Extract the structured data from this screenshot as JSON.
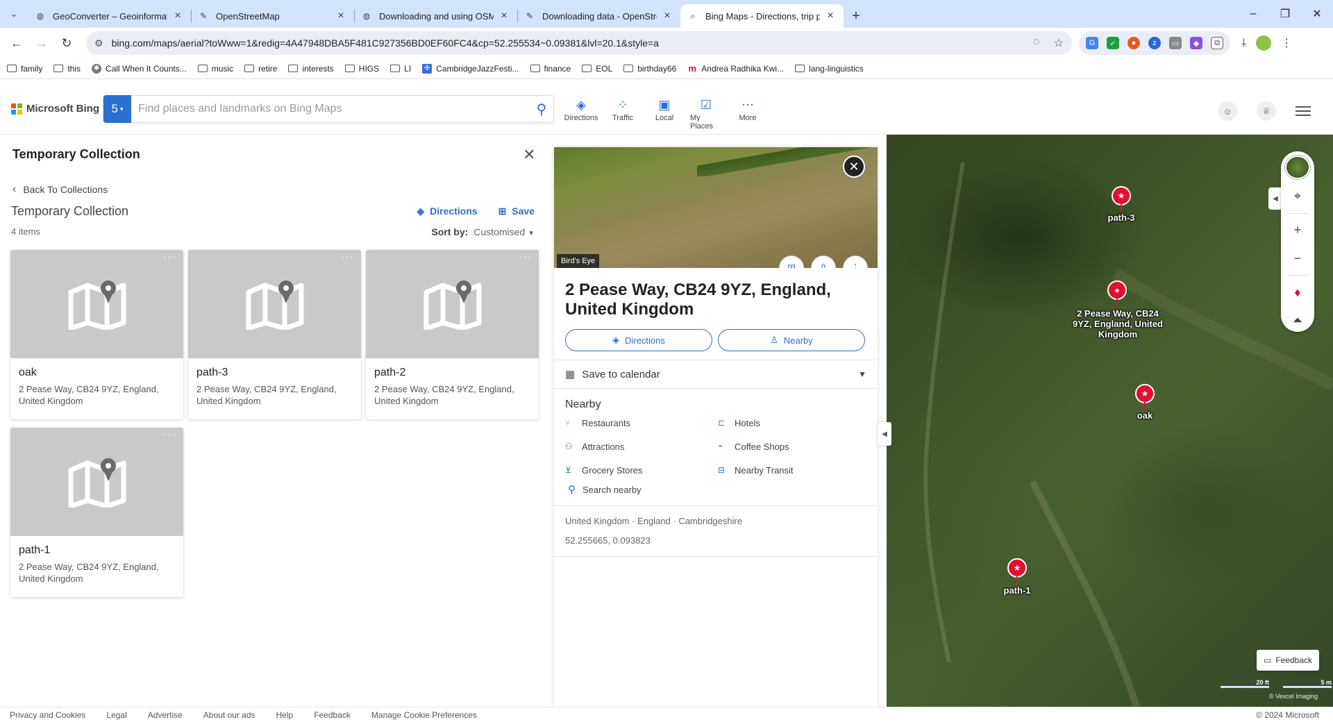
{
  "browser": {
    "tabs": [
      {
        "title": "GeoConverter – Geoinformation",
        "icon": "globe-icon"
      },
      {
        "title": "OpenStreetMap",
        "icon": "osm-icon"
      },
      {
        "title": "Downloading and using OSM d",
        "icon": "globe-icon"
      },
      {
        "title": "Downloading data - OpenStree",
        "icon": "osm-icon"
      },
      {
        "title": "Bing Maps - Directions, trip pla",
        "icon": "search-icon"
      }
    ],
    "url": "bing.com/maps/aerial?toWww=1&redig=4A47948DBA5F481C927356BD0EF60FC4&cp=52.255534~0.09381&lvl=20.1&style=a",
    "bookmarks": [
      {
        "label": "family",
        "type": "folder"
      },
      {
        "label": "this",
        "type": "folder"
      },
      {
        "label": "Call When It Counts...",
        "type": "site"
      },
      {
        "label": "music",
        "type": "folder"
      },
      {
        "label": "retire",
        "type": "folder"
      },
      {
        "label": "interests",
        "type": "folder"
      },
      {
        "label": "HIGS",
        "type": "folder"
      },
      {
        "label": "LI",
        "type": "folder"
      },
      {
        "label": "CambridgeJazzFesti...",
        "type": "site"
      },
      {
        "label": "finance",
        "type": "folder"
      },
      {
        "label": "EOL",
        "type": "folder"
      },
      {
        "label": "birthday66",
        "type": "folder"
      },
      {
        "label": "Andrea Radhika Kwi...",
        "type": "site"
      },
      {
        "label": "lang-linguistics",
        "type": "folder"
      }
    ]
  },
  "bing": {
    "logo_text": "Microsoft Bing",
    "search_badge": "5",
    "search_placeholder": "Find places and landmarks on Bing Maps",
    "nav": [
      {
        "label": "Directions",
        "icon": "directions-icon"
      },
      {
        "label": "Traffic",
        "icon": "traffic-icon"
      },
      {
        "label": "Local",
        "icon": "local-icon"
      },
      {
        "label": "My Places",
        "icon": "my-places-icon"
      },
      {
        "label": "More",
        "icon": "more-icon"
      }
    ]
  },
  "collection": {
    "title": "Temporary Collection",
    "back_label": "Back To Collections",
    "subtitle": "Temporary Collection",
    "count": "4 items",
    "directions_label": "Directions",
    "save_label": "Save",
    "sort_label": "Sort by:",
    "sort_value": "Customised",
    "items": [
      {
        "name": "oak",
        "address": "2 Pease Way, CB24 9YZ, England, United Kingdom"
      },
      {
        "name": "path-3",
        "address": "2 Pease Way, CB24 9YZ, England, United Kingdom"
      },
      {
        "name": "path-2",
        "address": "2 Pease Way, CB24 9YZ, England, United Kingdom"
      },
      {
        "name": "path-1",
        "address": "2 Pease Way, CB24 9YZ, England, United Kingdom"
      }
    ]
  },
  "details": {
    "birdseye_label": "Bird's Eye",
    "title": "2 Pease Way, CB24 9YZ, England, United Kingdom",
    "directions_label": "Directions",
    "nearby_label": "Nearby",
    "calendar_label": "Save to calendar",
    "nearby_heading": "Nearby",
    "nearby_items": [
      {
        "label": "Restaurants",
        "color": "#e8743b"
      },
      {
        "label": "Hotels",
        "color": "#c2399c"
      },
      {
        "label": "Attractions",
        "color": "#2970cf"
      },
      {
        "label": "Coffee Shops",
        "color": "#e8743b"
      },
      {
        "label": "Grocery Stores",
        "color": "#2970cf"
      },
      {
        "label": "Nearby Transit",
        "color": "#2970cf"
      }
    ],
    "search_nearby": "Search nearby",
    "region": "United Kingdom · England · Cambridgeshire",
    "coords": "52.255665, 0.093823"
  },
  "map": {
    "pins": [
      {
        "label": "path-3"
      },
      {
        "label": "2 Pease Way, CB24 9YZ, England, United Kingdom"
      },
      {
        "label": "oak"
      },
      {
        "label": "path-1"
      }
    ],
    "feedback_label": "Feedback",
    "scale_ft": "20 ft",
    "scale_m": "5 m",
    "attribution": "© Vexcel Imaging"
  },
  "footer": {
    "links": [
      "Privacy and Cookies",
      "Legal",
      "Advertise",
      "About our ads",
      "Help",
      "Feedback",
      "Manage Cookie Preferences"
    ],
    "copyright": "© 2024 Microsoft"
  },
  "colors": {
    "accent": "#2970cf",
    "pin": "#e30e32",
    "tabbar": "#d3e3fd"
  }
}
